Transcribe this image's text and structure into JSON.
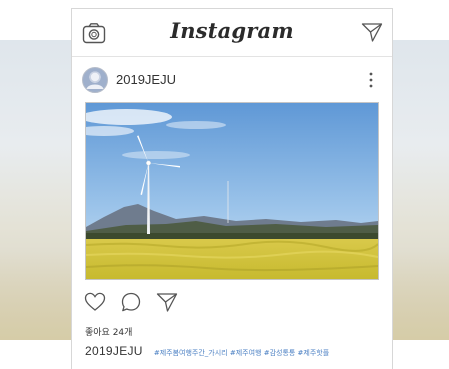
{
  "app": {
    "brand": "Instagram",
    "accent_color": "#3f72af"
  },
  "header": {
    "left_icon": "camera-icon",
    "right_icon": "send-icon"
  },
  "post": {
    "username": "2019JEJU",
    "avatar_icon": "user-avatar",
    "menu_icon": "more-vertical-icon",
    "photo_description_icon": "wind-turbine-field-photo",
    "actions": [
      {
        "name": "like",
        "icon": "heart-icon"
      },
      {
        "name": "comment",
        "icon": "comment-icon"
      },
      {
        "name": "share",
        "icon": "send-icon"
      }
    ],
    "likes": "좋아요 24개",
    "caption_user": "2019JEJU",
    "caption_tags": "#제주봄여행주간_가시리 #제주여행 #감성통통 #제주핫플"
  }
}
